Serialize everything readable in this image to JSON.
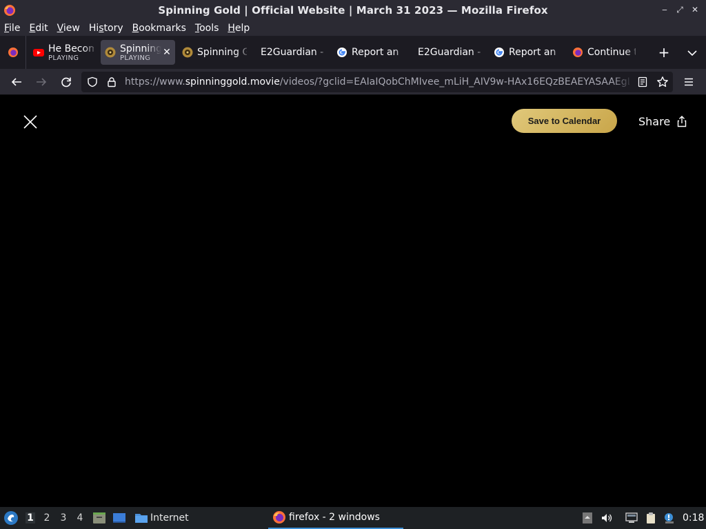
{
  "window": {
    "title": "Spinning Gold | Official Website | March 31 2023 — Mozilla Firefox",
    "controls": [
      "minimize-icon",
      "maximize-icon",
      "close-icon"
    ]
  },
  "menu": {
    "items": [
      {
        "label": "File",
        "mnemonic": "F"
      },
      {
        "label": "Edit",
        "mnemonic": "E"
      },
      {
        "label": "View",
        "mnemonic": "V"
      },
      {
        "label": "History",
        "mnemonic": "s"
      },
      {
        "label": "Bookmarks",
        "mnemonic": "B"
      },
      {
        "label": "Tools",
        "mnemonic": "T"
      },
      {
        "label": "Help",
        "mnemonic": "H"
      }
    ]
  },
  "tabs": [
    {
      "name": "He Becom",
      "status": "PLAYING",
      "icon": "youtube-icon"
    },
    {
      "name": "Spinning",
      "status": "PLAYING",
      "icon": "spinning-gold-icon",
      "active": true
    },
    {
      "name": "Spinning G",
      "status": "",
      "icon": "spinning-gold-icon"
    },
    {
      "name": "E2Guardian -",
      "status": "",
      "icon": "none"
    },
    {
      "name": "Report an",
      "status": "",
      "icon": "google-icon"
    },
    {
      "name": "E2Guardian -",
      "status": "",
      "icon": "none"
    },
    {
      "name": "Report an",
      "status": "",
      "icon": "google-icon"
    },
    {
      "name": "Continue t",
      "status": "",
      "icon": "firefox-icon"
    }
  ],
  "urlbar": {
    "prefix": "https://www.",
    "host": "spinninggold.movie",
    "path": "/videos/?gclid=EAIaIQobChMIvee_mLiH_AIV9w-HAx16EQzBEAEYASAAEgL"
  },
  "content": {
    "save_label": "Save to Calendar",
    "share_label": "Share"
  },
  "taskbar": {
    "workspaces": [
      "1",
      "2",
      "3",
      "4"
    ],
    "active_workspace": "1",
    "internet_label": "Internet",
    "task_label": "firefox - 2 windows",
    "clock": "0:18"
  },
  "colors": {
    "accent_gold": "#d4b55e",
    "toolbar": "#2b2a33",
    "tabstrip": "#1c1b22",
    "taskbar_highlight": "#3d8fd6"
  }
}
